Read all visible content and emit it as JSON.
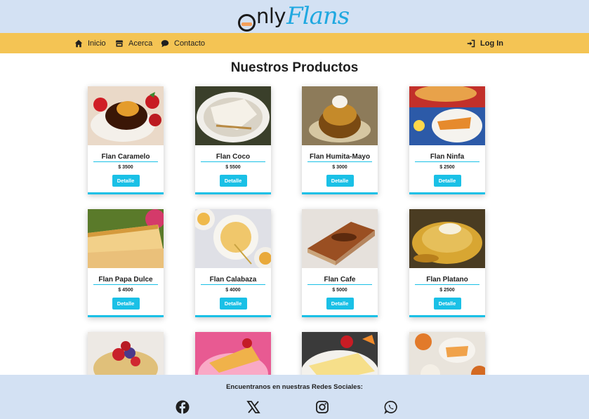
{
  "brand": {
    "only": "nly",
    "flans": "Flans"
  },
  "nav": {
    "inicio": "Inicio",
    "acerca": "Acerca",
    "contacto": "Contacto",
    "login": "Log In"
  },
  "page": {
    "title": "Nuestros Productos"
  },
  "detail_label": "Detalle",
  "products": [
    {
      "name": "Flan Caramelo",
      "price": "$ 3500"
    },
    {
      "name": "Flan Coco",
      "price": "$ 5500"
    },
    {
      "name": "Flan Humita-Mayo",
      "price": "$ 3000"
    },
    {
      "name": "Flan Ninfa",
      "price": "$ 2500"
    },
    {
      "name": "Flan Papa Dulce",
      "price": "$ 4500"
    },
    {
      "name": "Flan Calabaza",
      "price": "$ 4000"
    },
    {
      "name": "Flan Cafe",
      "price": "$ 5000"
    },
    {
      "name": "Flan Platano",
      "price": "$ 2500"
    }
  ],
  "footer": {
    "title": "Encuentranos en nuestras Redes Sociales:"
  },
  "colors": {
    "header_bg": "#d3e1f3",
    "nav_bg": "#f4c454",
    "accent": "#1ac0e6",
    "logo_blue": "#1fa8e0"
  },
  "icons": [
    "home-icon",
    "store-icon",
    "chat-icon",
    "login-icon",
    "facebook-icon",
    "x-icon",
    "instagram-icon",
    "whatsapp-icon"
  ]
}
